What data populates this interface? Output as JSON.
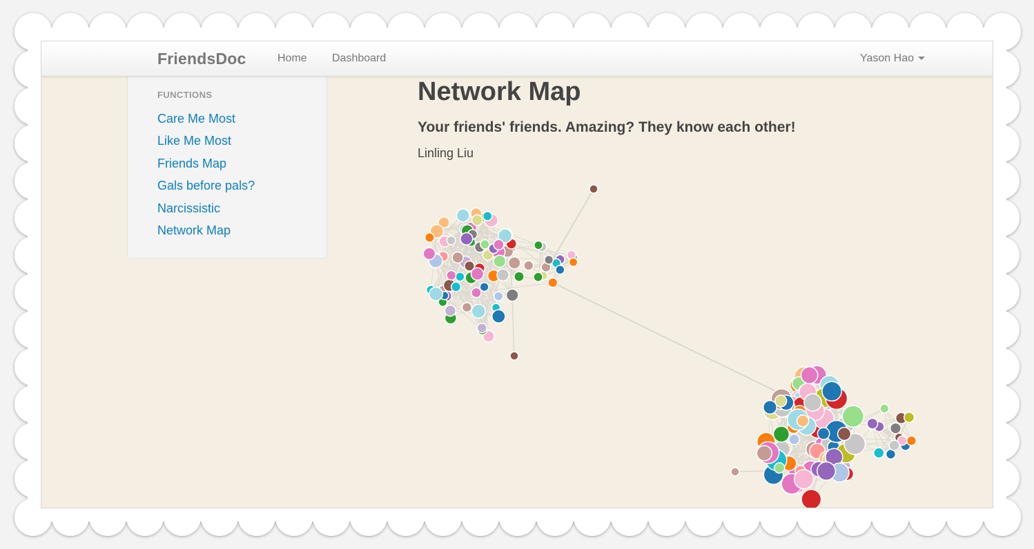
{
  "app": {
    "brand": "FriendsDoc"
  },
  "nav": {
    "items": [
      {
        "label": "Home"
      },
      {
        "label": "Dashboard"
      }
    ],
    "user": "Yason Hao"
  },
  "sidebar": {
    "header": "FUNCTIONS",
    "items": [
      {
        "label": "Care Me Most"
      },
      {
        "label": "Like Me Most"
      },
      {
        "label": "Friends Map"
      },
      {
        "label": "Gals before pals?"
      },
      {
        "label": "Narcissistic"
      },
      {
        "label": "Network Map"
      }
    ]
  },
  "main": {
    "title": "Network Map",
    "subtitle": "Your friends' friends. Amazing? They know each other!",
    "person": "Linling Liu"
  },
  "graph": {
    "palette": [
      "#1f77b4",
      "#aec7e8",
      "#ff7f0e",
      "#ffbb78",
      "#2ca02c",
      "#98df8a",
      "#d62728",
      "#ff9896",
      "#9467bd",
      "#c5b0d5",
      "#8c564b",
      "#c49c94",
      "#e377c2",
      "#f7b6d2",
      "#7f7f7f",
      "#c7c7c7",
      "#bcbd22",
      "#dbdb8d",
      "#17becf",
      "#9edae5"
    ],
    "edge_color": "#dcd8ce",
    "node_stroke": "#ffffff"
  }
}
